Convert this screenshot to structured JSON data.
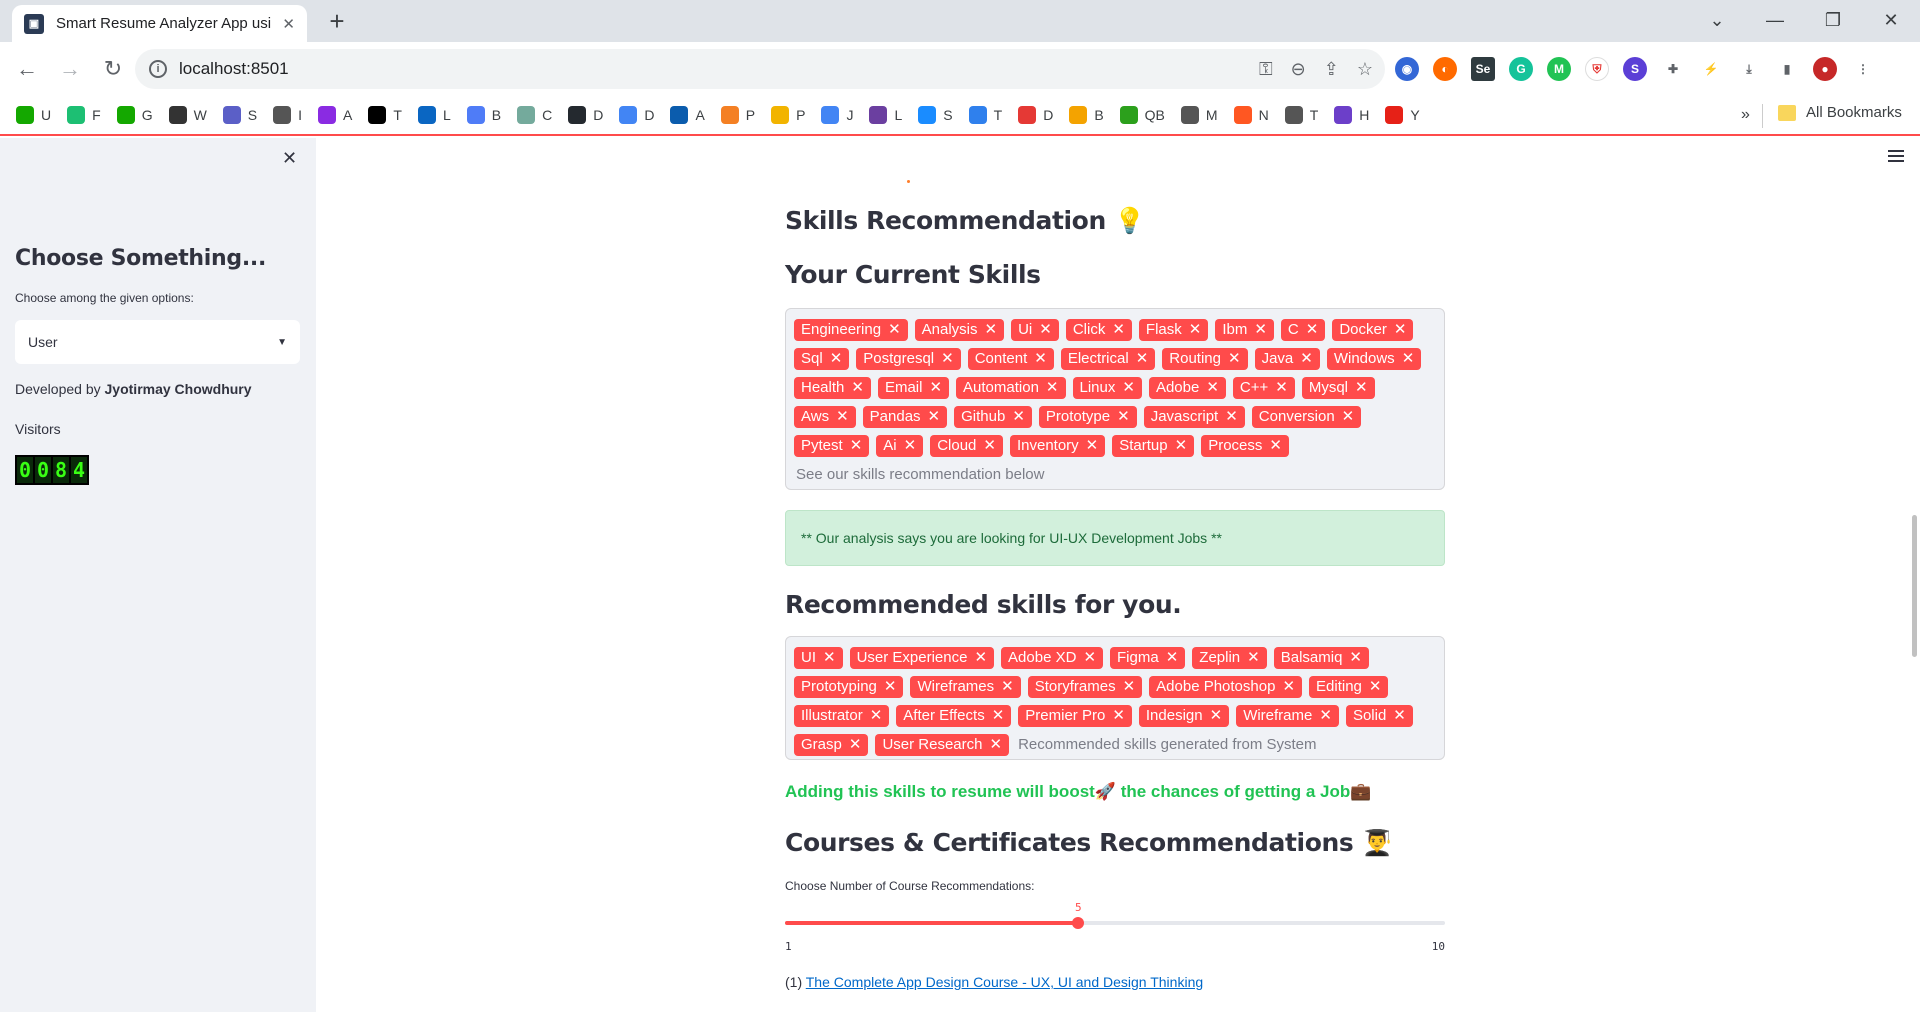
{
  "browser": {
    "tab_title": "Smart Resume Analyzer App usi",
    "url": "localhost:8501",
    "bookmarks": [
      {
        "label": "U",
        "color": "#14a800",
        "icon": "upwork-icon"
      },
      {
        "label": "F",
        "color": "#1dbf73",
        "icon": "fiverr-icon"
      },
      {
        "label": "G",
        "color": "#14a800",
        "icon": "guru-icon"
      },
      {
        "label": "W",
        "color": "#333333",
        "icon": "w-icon"
      },
      {
        "label": "S",
        "color": "#5b5fc7",
        "icon": "s-icon"
      },
      {
        "label": "I",
        "color": "#555555",
        "icon": "globe-icon"
      },
      {
        "label": "A",
        "color": "#8a2be2",
        "icon": "play-icon"
      },
      {
        "label": "T",
        "color": "#000000",
        "icon": "x-icon"
      },
      {
        "label": "L",
        "color": "#0a66c2",
        "icon": "linkedin-icon"
      },
      {
        "label": "B",
        "color": "#4f7cf7",
        "icon": "sparkle-icon"
      },
      {
        "label": "C",
        "color": "#74aa9c",
        "icon": "chatgpt-icon"
      },
      {
        "label": "D",
        "color": "#24292f",
        "icon": "github-icon"
      },
      {
        "label": "D",
        "color": "#4285f4",
        "icon": "docs-icon"
      },
      {
        "label": "A",
        "color": "#0b5cad",
        "icon": "a-icon"
      },
      {
        "label": "P",
        "color": "#f48024",
        "icon": "cloud-icon"
      },
      {
        "label": "P",
        "color": "#f2b400",
        "icon": "chart-icon"
      },
      {
        "label": "J",
        "color": "#4285f4",
        "icon": "docs-icon"
      },
      {
        "label": "L",
        "color": "#6b3fa0",
        "icon": "l-icon"
      },
      {
        "label": "S",
        "color": "#1a8cff",
        "icon": "s2-icon"
      },
      {
        "label": "T",
        "color": "#2f80ed",
        "icon": "arrow-up-icon"
      },
      {
        "label": "D",
        "color": "#e53935",
        "icon": "d-icon"
      },
      {
        "label": "B",
        "color": "#f4a300",
        "icon": "blogger-icon"
      },
      {
        "label": "QB",
        "color": "#2ca01c",
        "icon": "qb-icon"
      },
      {
        "label": "M",
        "color": "#555555",
        "icon": "mail-icon"
      },
      {
        "label": "N",
        "color": "#ff5722",
        "icon": "n-icon"
      },
      {
        "label": "T",
        "color": "#555555",
        "icon": "t-icon"
      },
      {
        "label": "H",
        "color": "#6c3fc9",
        "icon": "h-icon"
      },
      {
        "label": "Y",
        "color": "#e62117",
        "icon": "y-icon"
      }
    ],
    "more": "»",
    "all_bookmarks": "All Bookmarks"
  },
  "sidebar": {
    "heading": "Choose Something...",
    "select_label": "Choose among the given options:",
    "select_value": "User",
    "developed_by_prefix": "Developed by ",
    "developer": "Jyotirmay Chowdhury",
    "visitors_label": "Visitors",
    "visitor_digits": [
      "0",
      "0",
      "8",
      "4"
    ]
  },
  "main": {
    "skills_recommendation_heading": "Skills Recommendation 💡",
    "current_skills_heading": "Your Current Skills",
    "current_skills": [
      "Engineering",
      "Analysis",
      "Ui",
      "Click",
      "Flask",
      "Ibm",
      "C",
      "Docker",
      "Sql",
      "Postgresql",
      "Content",
      "Electrical",
      "Routing",
      "Java",
      "Windows",
      "Health",
      "Email",
      "Automation",
      "Linux",
      "Adobe",
      "C++",
      "Mysql",
      "Aws",
      "Pandas",
      "Github",
      "Prototype",
      "Javascript",
      "Conversion",
      "Pytest",
      "Ai",
      "Cloud",
      "Inventory",
      "Startup",
      "Process"
    ],
    "current_skills_placeholder": "See our skills recommendation below",
    "analysis_message": "** Our analysis says you are looking for UI-UX Development Jobs **",
    "recommended_heading": "Recommended skills for you.",
    "recommended_skills": [
      "UI",
      "User Experience",
      "Adobe XD",
      "Figma",
      "Zeplin",
      "Balsamiq",
      "Prototyping",
      "Wireframes",
      "Storyframes",
      "Adobe Photoshop",
      "Editing",
      "Illustrator",
      "After Effects",
      "Premier Pro",
      "Indesign",
      "Wireframe",
      "Solid",
      "Grasp",
      "User Research"
    ],
    "recommended_placeholder": "Recommended skills generated from System",
    "boost_message": "Adding this skills to resume will boost🚀 the chances of getting a Job💼",
    "courses_heading": "Courses & Certificates Recommendations 👨‍🎓",
    "slider_label": "Choose Number of Course Recommendations:",
    "slider_value": 5,
    "slider_min": 1,
    "slider_max": 10,
    "course_number": "(1) ",
    "course_title": "The Complete App Design Course - UX, UI and Design Thinking"
  },
  "colors": {
    "accent": "#ff4b4b",
    "success_bg": "#d2f0dc",
    "success_text": "#1d6b3a",
    "boost_text": "#21c354",
    "link": "#0068c9"
  }
}
